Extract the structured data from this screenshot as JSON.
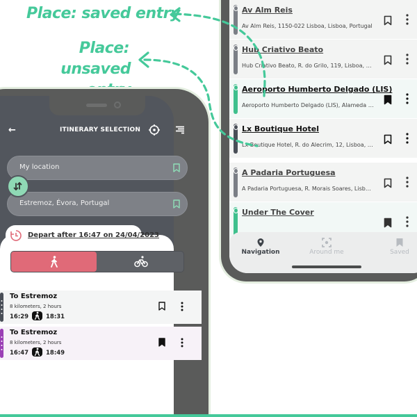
{
  "annotations": {
    "saved_label": "Place: saved entry",
    "unsaved_label_line1": "Place:",
    "unsaved_label_line2": "unsaved entry",
    "color": "#45c99a"
  },
  "places_screen": {
    "places": [
      {
        "name": "Av Alm Reis",
        "address": "Av Alm Reis, 1150-022 Lisboa, Lisboa, Portugal",
        "saved": false
      },
      {
        "name": "Hub Criativo Beato",
        "address": "Hub Criativo Beato, R. do Grilo, 119, Lisboa, Lisb…",
        "saved": false
      },
      {
        "name": "Aeroporto Humberto Delgado (LIS)",
        "address": "Aeroporto Humberto Delgado (LIS), Alameda das…",
        "saved": true
      },
      {
        "name": "Lx Boutique Hotel",
        "address": "Lx Boutique Hotel, R. do Alecrim, 12, Lisboa, Lisb…",
        "saved": false
      },
      {
        "name": "A Padaria Portuguesa",
        "address": "A Padaria Portuguesa, R. Morais Soares, Lisboa, L…",
        "saved": false
      },
      {
        "name": "Under The Cover",
        "address": "",
        "saved": true
      }
    ],
    "bottom_nav": [
      {
        "label": "Navigation",
        "icon": "map-pin-icon",
        "active": true
      },
      {
        "label": "Around me",
        "icon": "focus-icon",
        "active": false
      },
      {
        "label": "Saved",
        "icon": "bookmark-icon",
        "active": false
      }
    ]
  },
  "itinerary_screen": {
    "title": "ITINERARY SELECTION",
    "from_field": "My location",
    "to_field": "Estremoz, Évora, Portugal",
    "depart_label": "Depart after 16:47 on 24/04/2023",
    "modes": [
      {
        "name": "walk",
        "active": true
      },
      {
        "name": "bike",
        "active": false
      }
    ],
    "itineraries": [
      {
        "destination": "To Estremoz",
        "summary": "8 kilometers, 2 hours",
        "depart": "16:29",
        "arrive": "18:31",
        "saved": false,
        "color": "#4a4f58"
      },
      {
        "destination": "To Estremoz",
        "summary": "8 kilometers, 2 hours",
        "depart": "16:47",
        "arrive": "18:49",
        "saved": true,
        "color": "#9b3fb5"
      }
    ]
  },
  "colors": {
    "accent": "#45c99a",
    "walk_active": "#e06a78",
    "saved_strip": "#3fc08d",
    "header_bg": "#52565d"
  }
}
